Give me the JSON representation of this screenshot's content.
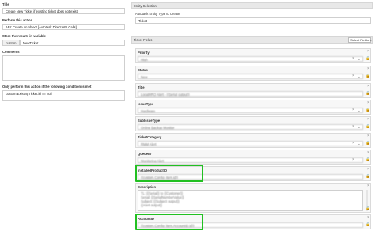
{
  "left": {
    "title_label": "Title",
    "title_value": "Create New Ticket if existing ticket does not exist",
    "perform_label": "Perform this action",
    "perform_value": "API: Create an object [Autotask Direct API Calls]",
    "store_label": "Store the results in variable",
    "store_prefix": "custom.",
    "store_value": "NewTicket",
    "comments_label": "Comments",
    "comments_value": "",
    "condition_label": "Only perform this action if the following condition is met",
    "condition_value": "custom.ExistingTicket.id == null"
  },
  "right": {
    "entity_section": "Entity Selection",
    "entity_label": "Autotask Entity Type to Create",
    "entity_value": "Ticket",
    "ticket_fields_section": "Ticket Fields",
    "select_fields_button": "Select Fields",
    "fields": [
      {
        "label": "Priority",
        "value": "High"
      },
      {
        "label": "Status",
        "value": "New"
      },
      {
        "label": "Title",
        "value": "LocalHRO Alert - {{Serial output}}"
      },
      {
        "label": "IssueType",
        "value": "Hardware"
      },
      {
        "label": "SubIssueType",
        "value": "Online Backup Monitor"
      },
      {
        "label": "TicketCategory",
        "value": "RMM Alert"
      },
      {
        "label": "QueueID",
        "value": "Monitoring Alert"
      },
      {
        "label": "InstalledProductID",
        "value": "{{custom.Config_item.id}}"
      },
      {
        "label": "Description",
        "value": "TL: {{Serial}} to {{Customer}}"
      },
      {
        "label": "AccountID",
        "value": "{{custom.Config_item.AccountID.id}}"
      }
    ],
    "description_lines": [
      "TL: {{Serial}} to {{Customer}}",
      "Serial: {{SerialNumberValue}}",
      "Subject: {{Subject output}}",
      "{{Alert output}}"
    ]
  }
}
